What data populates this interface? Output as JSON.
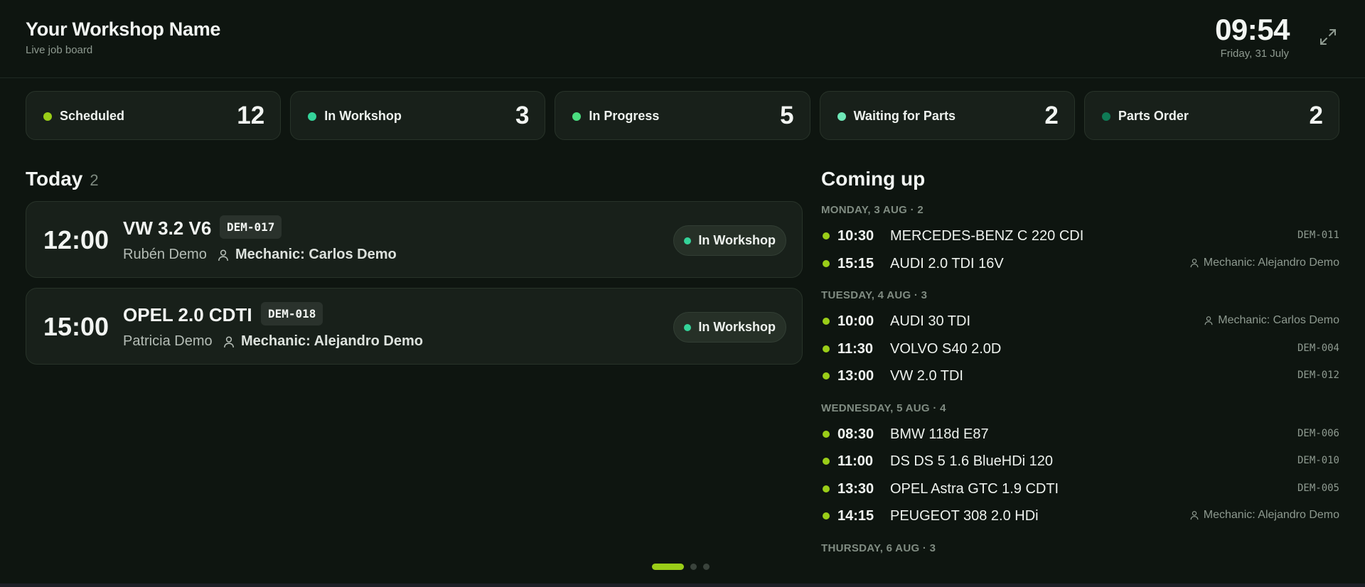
{
  "header": {
    "title": "Your Workshop Name",
    "subtitle": "Live job board",
    "time": "09:54",
    "date": "Friday, 31 July",
    "fullscreen_icon": "expand-icon"
  },
  "stats": [
    {
      "label": "Scheduled",
      "count": "12",
      "color": "#9acd18"
    },
    {
      "label": "In Workshop",
      "count": "3",
      "color": "#34d399"
    },
    {
      "label": "In Progress",
      "count": "5",
      "color": "#4ade80"
    },
    {
      "label": "Waiting for Parts",
      "count": "2",
      "color": "#6ee7b7"
    },
    {
      "label": "Parts Order",
      "count": "2",
      "color": "#0f7a55"
    }
  ],
  "today": {
    "title": "Today",
    "count": "2",
    "jobs": [
      {
        "time": "12:00",
        "vehicle": "VW 3.2 V6",
        "plate": "DEM-017",
        "customer": "Rubén Demo",
        "mechanic": "Mechanic: Carlos Demo",
        "status": "In Workshop"
      },
      {
        "time": "15:00",
        "vehicle": "OPEL 2.0 CDTI",
        "plate": "DEM-018",
        "customer": "Patricia Demo",
        "mechanic": "Mechanic: Alejandro Demo",
        "status": "In Workshop"
      }
    ]
  },
  "coming_up": {
    "title": "Coming up",
    "days": [
      {
        "heading": "MONDAY, 3 AUG · 2",
        "items": [
          {
            "time": "10:30",
            "vehicle": "MERCEDES-BENZ C 220 CDI",
            "plate": "DEM-011"
          },
          {
            "time": "15:15",
            "vehicle": "AUDI 2.0 TDI 16V",
            "mechanic": "Mechanic: Alejandro Demo"
          }
        ]
      },
      {
        "heading": "TUESDAY, 4 AUG · 3",
        "items": [
          {
            "time": "10:00",
            "vehicle": "AUDI 30 TDI",
            "mechanic": "Mechanic: Carlos Demo"
          },
          {
            "time": "11:30",
            "vehicle": "VOLVO S40 2.0D",
            "plate": "DEM-004"
          },
          {
            "time": "13:00",
            "vehicle": "VW 2.0 TDI",
            "plate": "DEM-012"
          }
        ]
      },
      {
        "heading": "WEDNESDAY, 5 AUG · 4",
        "items": [
          {
            "time": "08:30",
            "vehicle": "BMW 118d E87",
            "plate": "DEM-006"
          },
          {
            "time": "11:00",
            "vehicle": "DS DS 5 1.6 BlueHDi 120",
            "plate": "DEM-010"
          },
          {
            "time": "13:30",
            "vehicle": "OPEL Astra GTC 1.9 CDTI",
            "plate": "DEM-005"
          },
          {
            "time": "14:15",
            "vehicle": "PEUGEOT 308 2.0 HDi",
            "mechanic": "Mechanic: Alejandro Demo"
          }
        ]
      },
      {
        "heading": "THURSDAY, 6 AUG · 3",
        "items": []
      }
    ]
  },
  "pager": {
    "pages": 3,
    "active_page": 1,
    "active_color": "#9acd18"
  }
}
